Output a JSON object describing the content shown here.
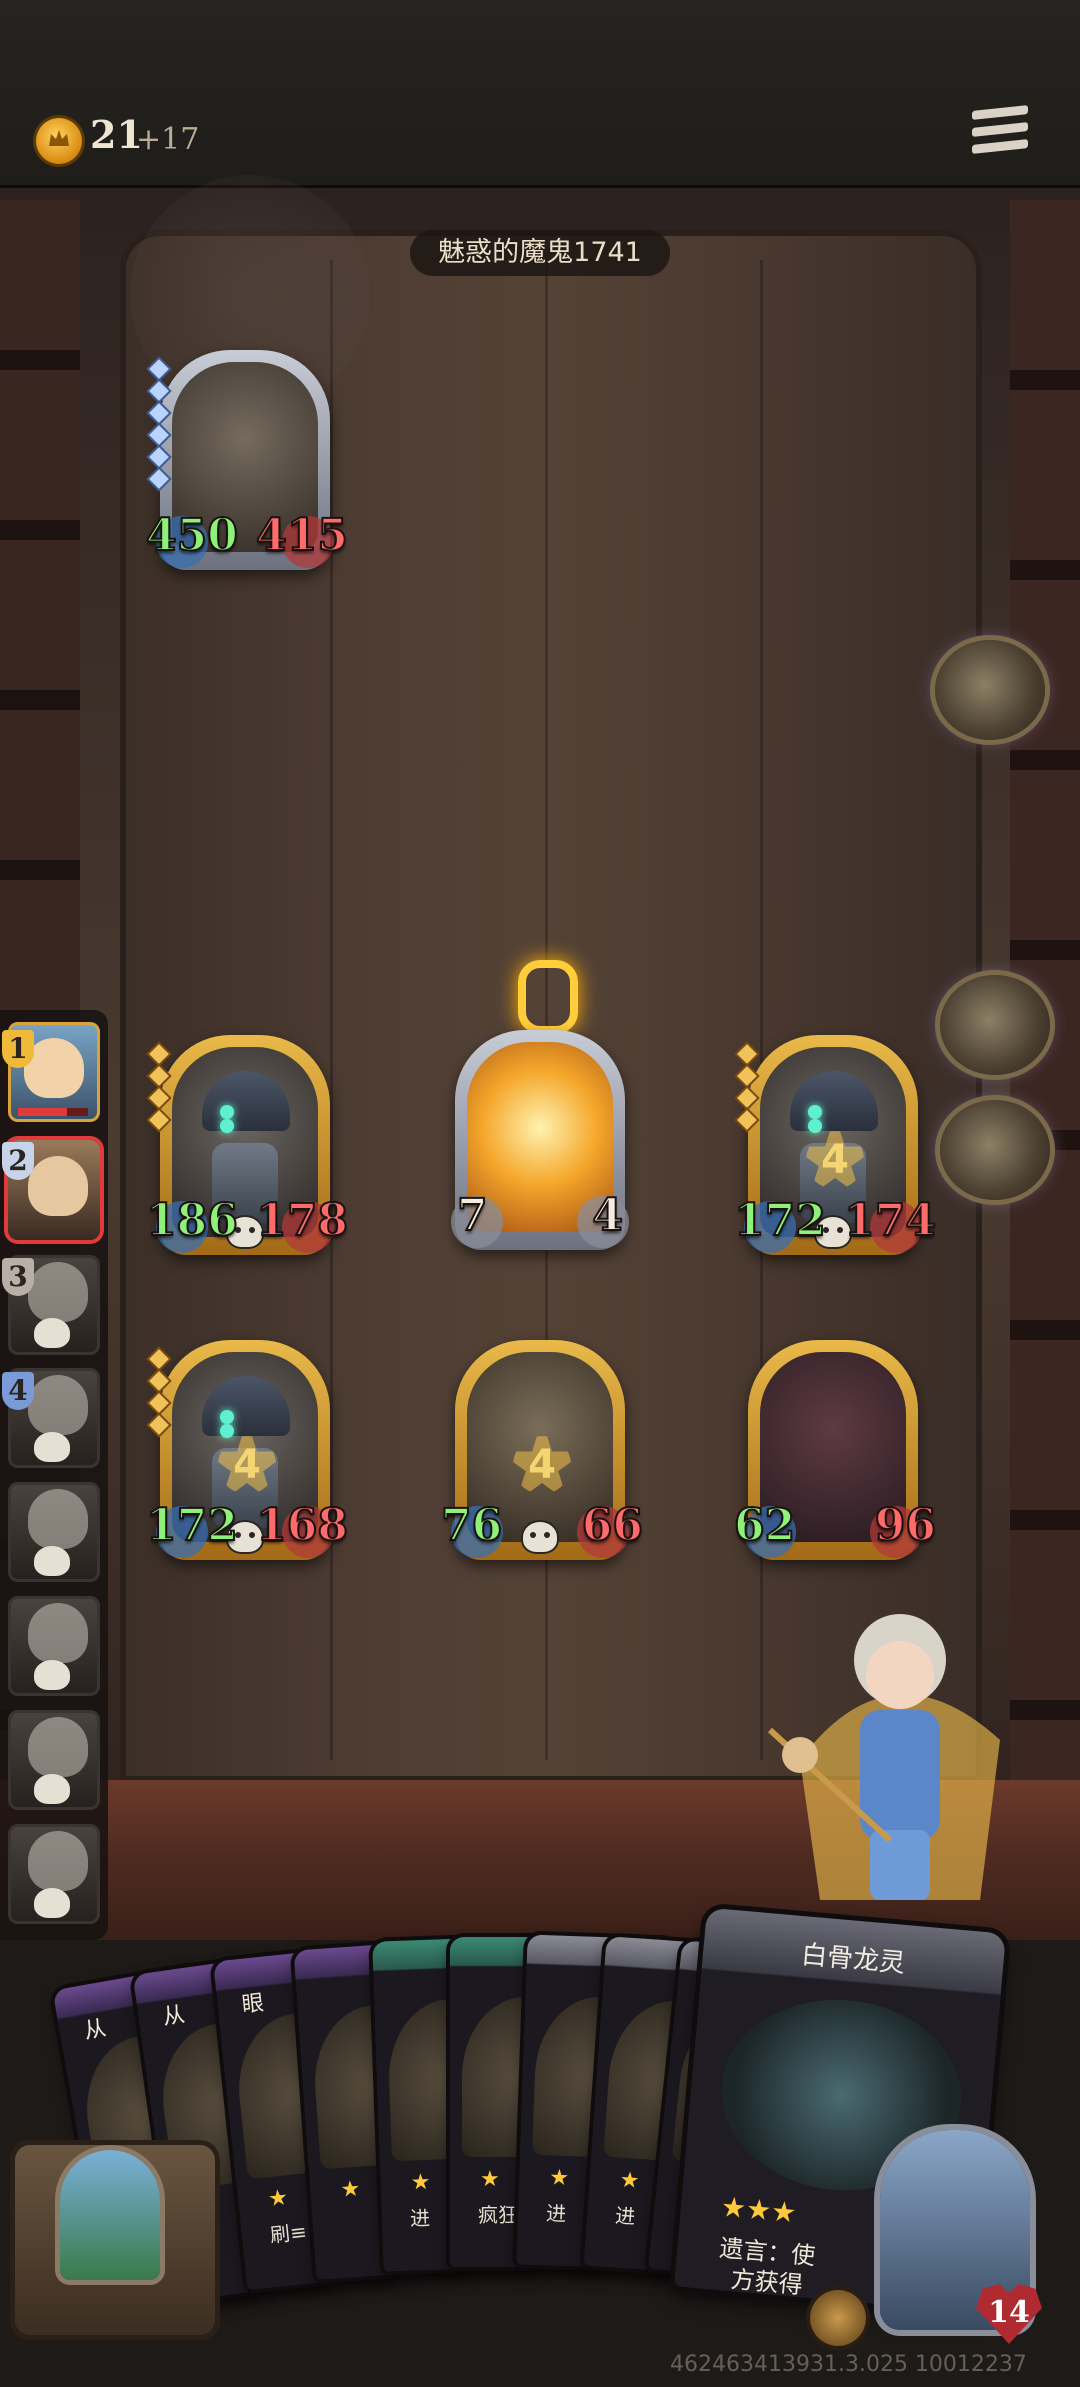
{
  "header": {
    "gold": "21",
    "gold_increment": "+17",
    "coin_icon": "gold-coin-icon",
    "menu_icon": "menu-icon"
  },
  "opponent": {
    "name": "魅惑的魔鬼1741",
    "minion": {
      "attack": "450",
      "health": "415"
    }
  },
  "board": {
    "row1": [
      {
        "attack": "186",
        "health": "178"
      },
      {
        "attack": "7",
        "health": "4",
        "top_tag": "0"
      },
      {
        "attack": "172",
        "health": "174",
        "star": "4"
      }
    ],
    "row2": [
      {
        "attack": "172",
        "health": "168",
        "star": "4"
      },
      {
        "attack": "76",
        "health": "66",
        "star": "4"
      },
      {
        "attack": "62",
        "health": "96"
      }
    ]
  },
  "leaderboard": {
    "ranks": [
      "1",
      "2",
      "3",
      "4"
    ]
  },
  "hand": {
    "cards": [
      {
        "name": "从"
      },
      {
        "name": "从"
      },
      {
        "name": "眼",
        "text": "刷≡"
      },
      {
        "name": ""
      },
      {
        "name": "",
        "text": "进"
      },
      {
        "name": "",
        "text": "疯狂"
      },
      {
        "name": "",
        "text": "进"
      },
      {
        "name": "",
        "text": "进"
      },
      {
        "name": "",
        "text": "进"
      }
    ],
    "featured": {
      "title": "白骨龙灵",
      "stars": "★★★",
      "text_line1": "遗言：使",
      "text_line2": "方获得"
    }
  },
  "player": {
    "health": "14"
  },
  "footer": {
    "build_id": "462463413931.3.025 10012237"
  },
  "colors": {
    "attack": "#8ef27a",
    "health": "#ff6a6a",
    "gold_frame": "#e9b949"
  }
}
